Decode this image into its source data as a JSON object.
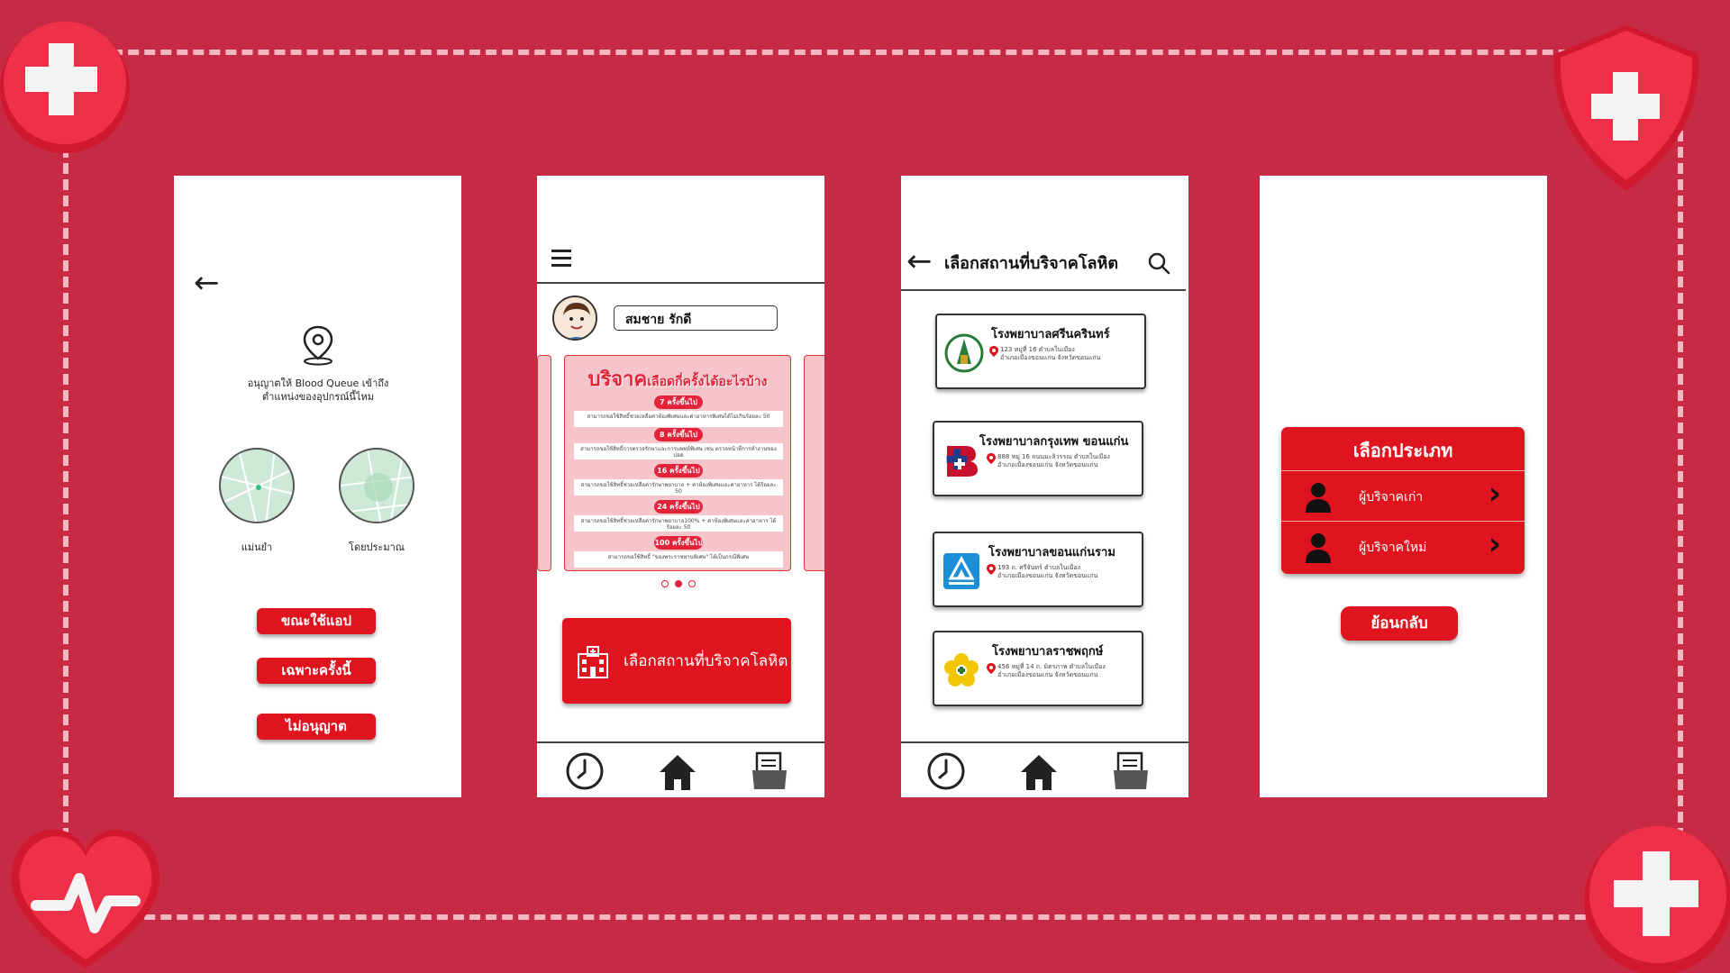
{
  "phone1": {
    "back_icon": "back-arrow-icon",
    "location_icon": "location-pin-icon",
    "permission_text_line1": "อนุญาตให้ Blood Queue เข้าถึง",
    "permission_text_line2": "ตำแหน่งของอุปกรณ์นี้ไหม",
    "precise_label": "แม่นยำ",
    "approximate_label": "โดยประมาณ",
    "buttons": [
      "ขณะใช้แอป",
      "เฉพาะครั้งนี้",
      "ไม่อนุญาต"
    ]
  },
  "phone2": {
    "menu_icon": "hamburger-menu-icon",
    "user_name": "สมชาย รักดี",
    "banner_title": "บริจาค",
    "banner_subtitle": "เลือดกี่ครั้งได้อะไรบ้าง",
    "tiers": [
      {
        "label": "7 ครั้งขึ้นไป",
        "desc": "สามารถขอใช้สิทธิ์ช่วยเหลือค่าห้องพิเศษและค่าอาหารพิเศษได้ไม่เกินร้อยละ 50"
      },
      {
        "label": "8 ครั้งขึ้นไป",
        "desc": "สามารถขอใช้สิทธิ์การตรวจรักษาและการแพทย์พิเศษ เช่น ตรวจหน้าที่การทำงานของปอด"
      },
      {
        "label": "16 ครั้งขึ้นไป",
        "desc": "สามารถขอใช้สิทธิ์ช่วยเหลือค่ารักษาพยาบาล + ค่าห้องพิเศษและค่าอาหาร ได้ร้อยละ 50"
      },
      {
        "label": "24 ครั้งขึ้นไป",
        "desc": "สามารถขอใช้สิทธิ์ช่วยเหลือค่ารักษาพยาบาล100% + ค่าห้องพิเศษและค่าอาหาร ได้ร้อยละ 50"
      },
      {
        "label": "100 ครั้งขึ้นไป",
        "desc": "สามารถขอใช้สิทธิ์ \"ของพระราชทานพิเศษ\" ได้เป็นกรณีพิเศษ"
      }
    ],
    "carousel_active_index": 1,
    "cta_label": "เลือกสถานที่บริจาคโลหิต",
    "cta_icon": "hospital-building-icon"
  },
  "phone3": {
    "title": "เลือกสถานที่บริจาคโลหิต",
    "search_icon": "search-icon",
    "hospitals": [
      {
        "name": "โรงพยาบาลศรีนครินทร์",
        "addr1": "123 หมู่ที่ 16 ตำบลในเมือง",
        "addr2": "อำเภอเมืองขอนแก่น จังหวัดขอนแก่น"
      },
      {
        "name": "โรงพยาบาลกรุงเทพ ขอนแก่น",
        "addr1": "888 หมู่ 16 ถนนมะลิวรรณ ตำบลในเมือง",
        "addr2": "อำเภอเมืองขอนแก่น จังหวัดขอนแก่น"
      },
      {
        "name": "โรงพยาบาลขอนแก่นราม",
        "addr1": "193 ถ. ศรีจันทร์ ตำบลในเมือง",
        "addr2": "อำเภอเมืองขอนแก่น จังหวัดขอนแก่น"
      },
      {
        "name": "โรงพยาบาลราชพฤกษ์",
        "addr1": "456 หมู่ที่ 14 ถ. มิตรภาพ ตำบลในเมือง",
        "addr2": "อำเภอเมืองขอนแก่น จังหวัดขอนแก่น"
      }
    ]
  },
  "phone4": {
    "card_title": "เลือกประเภท",
    "options": [
      "ผู้บริจาคเก่า",
      "ผู้บริจาคใหม่"
    ],
    "back_button": "ย้อนกลับ"
  },
  "tabbar": {
    "icons": [
      "history-clock-icon",
      "home-icon",
      "documents-icon"
    ]
  },
  "colors": {
    "background": "#c72a45",
    "accent_red": "#e0141e",
    "dash": "#f4b6c0"
  }
}
